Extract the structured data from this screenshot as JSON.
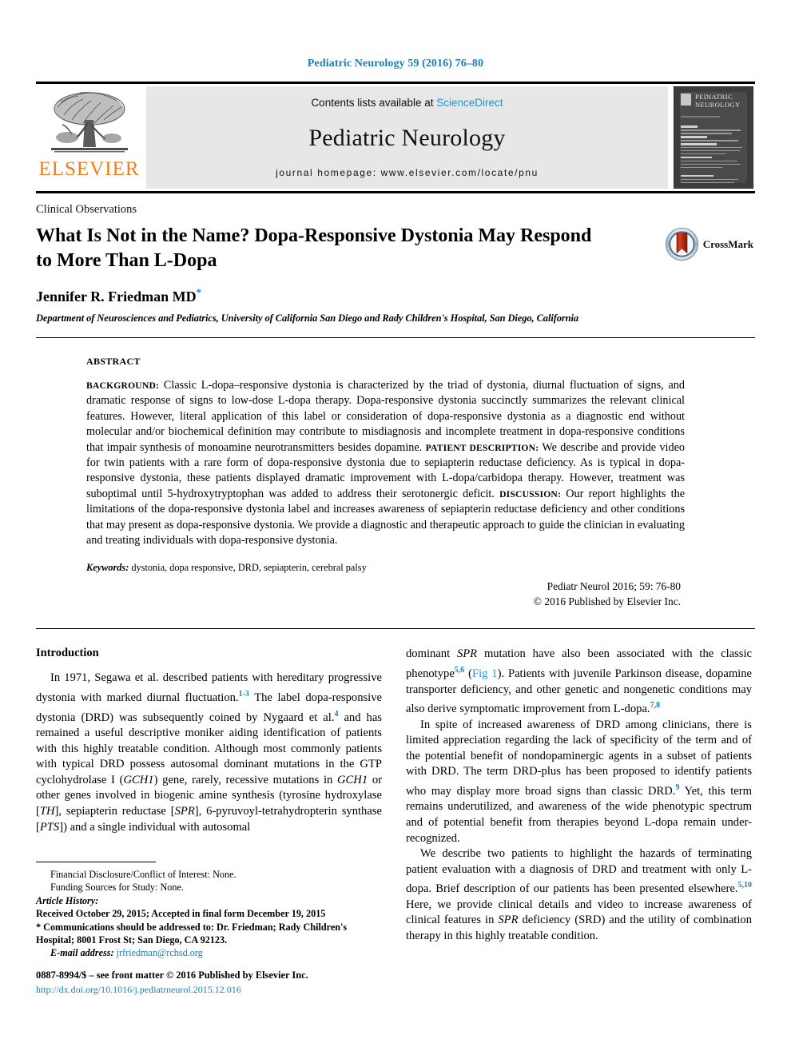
{
  "running_head": "Pediatric Neurology 59 (2016) 76–80",
  "masthead": {
    "publisher_name": "ELSEVIER",
    "contents_prefix": "Contents lists available at ",
    "contents_link": "ScienceDirect",
    "journal_title": "Pediatric Neurology",
    "homepage": "journal homepage: www.elsevier.com/locate/pnu",
    "cover_title_line1": "PEDIATRIC",
    "cover_title_line2": "NEUROLOGY"
  },
  "article": {
    "section_type": "Clinical Observations",
    "title": "What Is Not in the Name? Dopa-Responsive Dystonia May Respond to More Than L-Dopa",
    "crossmark_label": "CrossMark",
    "author": "Jennifer R. Friedman MD",
    "author_marker": "*",
    "affiliation": "Department of Neurosciences and Pediatrics, University of California San Diego and Rady Children's Hospital, San Diego, California"
  },
  "abstract": {
    "heading": "ABSTRACT",
    "label_background": "BACKGROUND:",
    "text_background": " Classic L-dopa–responsive dystonia is characterized by the triad of dystonia, diurnal fluctuation of signs, and dramatic response of signs to low-dose L-dopa therapy. Dopa-responsive dystonia succinctly summarizes the relevant clinical features. However, literal application of this label or consideration of dopa-responsive dystonia as a diagnostic end without molecular and/or biochemical definition may contribute to misdiagnosis and incomplete treatment in dopa-responsive conditions that impair synthesis of monoamine neurotransmitters besides dopamine. ",
    "label_patient": "PATIENT DESCRIPTION:",
    "text_patient": " We describe and provide video for twin patients with a rare form of dopa-responsive dystonia due to sepiapterin reductase deficiency. As is typical in dopa-responsive dystonia, these patients displayed dramatic improvement with L-dopa/carbidopa therapy. However, treatment was suboptimal until 5-hydroxytryptophan was added to address their serotonergic deficit. ",
    "label_discussion": "DISCUSSION:",
    "text_discussion": " Our report highlights the limitations of the dopa-responsive dystonia label and increases awareness of sepiapterin reductase deficiency and other conditions that may present as dopa-responsive dystonia. We provide a diagnostic and therapeutic approach to guide the clinician in evaluating and treating individuals with dopa-responsive dystonia.",
    "keywords_label": "Keywords:",
    "keywords_text": " dystonia, dopa responsive, DRD, sepiapterin, cerebral palsy",
    "citation": "Pediatr Neurol 2016; 59: 76-80",
    "copyright": "© 2016 Published by Elsevier Inc."
  },
  "body": {
    "intro_heading": "Introduction",
    "left_p1_a": "In 1971, Segawa et al. described patients with hereditary progressive dystonia with marked diurnal fluctuation.",
    "left_p1_ref1": "1-3",
    "left_p1_b": " The label dopa-responsive dystonia (DRD) was subsequently coined by Nygaard et al.",
    "left_p1_ref2": "4",
    "left_p1_c": " and has remained a useful descriptive moniker aiding identification of patients with this highly treatable condition. Although most commonly patients with typical DRD possess autosomal dominant mutations in the GTP cyclohydrolase I (",
    "gene_gch1": "GCH1",
    "left_p1_d": ") gene, rarely, recessive mutations in ",
    "gene_gch1_b": "GCH1",
    "left_p1_e": " or other genes involved in biogenic amine synthesis (tyrosine hydroxylase [",
    "gene_th": "TH",
    "left_p1_f": "], sepiapterin reductase [",
    "gene_spr": "SPR",
    "left_p1_g": "], 6-pyruvoyl-tetrahydropterin synthase [",
    "gene_pts": "PTS",
    "left_p1_h": "]) and a single individual with autosomal",
    "right_p1_a": "dominant ",
    "gene_spr_r": "SPR",
    "right_p1_b": " mutation have also been associated with the classic phenotype",
    "right_p1_ref1": "5,6",
    "right_p1_c": " (",
    "fig_link": "Fig 1",
    "right_p1_d": "). Patients with juvenile Parkinson disease, dopamine transporter deficiency, and other genetic and nongenetic conditions may also derive symptomatic improvement from L-dopa.",
    "right_p1_ref2": "7,8",
    "right_p2_a": "In spite of increased awareness of DRD among clinicians, there is limited appreciation regarding the lack of specificity of the term and of the potential benefit of nondopaminergic agents in a subset of patients with DRD. The term DRD-plus has been proposed to identify patients who may display more broad signs than classic DRD.",
    "right_p2_ref": "9",
    "right_p2_b": " Yet, this term remains underutilized, and awareness of the wide phenotypic spectrum and of potential benefit from therapies beyond L-dopa remain under-recognized.",
    "right_p3_a": "We describe two patients to highlight the hazards of terminating patient evaluation with a diagnosis of DRD and treatment with only L-dopa. Brief description of our patients has been presented elsewhere.",
    "right_p3_ref": "5,10",
    "right_p3_b": " Here, we provide clinical details and video to increase awareness of clinical features in ",
    "gene_spr_r2": "SPR",
    "right_p3_c": " deficiency (SRD) and the utility of combination therapy in this highly treatable condition."
  },
  "footnotes": {
    "disclosure": "Financial Disclosure/Conflict of Interest: None.",
    "funding": "Funding Sources for Study: None.",
    "history_label": "Article History:",
    "history_text": "Received October 29, 2015; Accepted in final form December 19, 2015",
    "correspondence_marker": "*",
    "correspondence": " Communications should be addressed to: Dr. Friedman; Rady Children's Hospital; 8001 Frost St; San Diego, CA 92123.",
    "email_label": "E-mail address:",
    "email": "jrfriedman@rchsd.org"
  },
  "colophon": {
    "issn_line": "0887-8994/$ – see front matter © 2016 Published by Elsevier Inc.",
    "doi": "http://dx.doi.org/10.1016/j.pediatrneurol.2015.12.016"
  },
  "colors": {
    "link_blue": "#1b7fb5",
    "sciencedirect_blue": "#2394d1",
    "elsevier_orange": "#f07d18",
    "masthead_gray": "#e7e7e7"
  }
}
